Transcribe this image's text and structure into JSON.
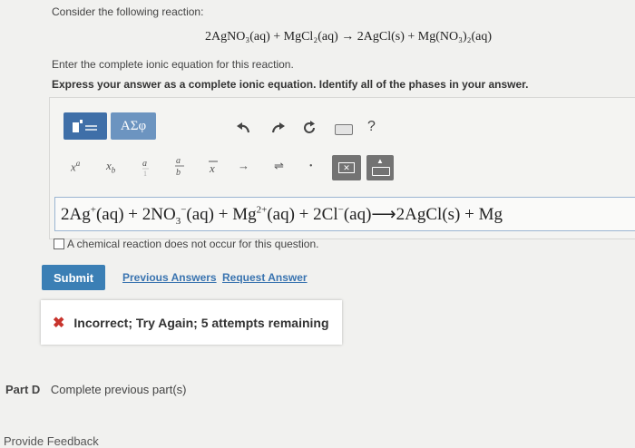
{
  "question": "Consider the following reaction:",
  "reaction": "2AgNO₃(aq) + MgCl₂(aq) → 2AgCl(s) + Mg(NO₃)₂(aq)",
  "prompt": "Enter the complete ionic equation for this reaction.",
  "instruction": "Express your answer as a complete ionic equation. Identify all of the phases in your answer.",
  "toolbar": {
    "greek_label": "ΑΣφ",
    "help_label": "?",
    "icons": [
      "templates-icon",
      "greek-letters-icon",
      "undo-icon",
      "redo-icon",
      "reset-icon",
      "keyboard-shortcuts-icon",
      "help-icon"
    ]
  },
  "symbols": {
    "superscript": "x",
    "superscript_exp": "a",
    "subscript": "x",
    "subscript_sub": "b",
    "arrow": "→",
    "equilibrium": "⇌",
    "dot": "•"
  },
  "answer": {
    "parts": [
      {
        "text": "2Ag"
      },
      {
        "sup": "+"
      },
      {
        "text": "(aq) + 2NO"
      },
      {
        "sub": "3"
      },
      {
        "sup": "−"
      },
      {
        "text": "(aq) + Mg"
      },
      {
        "sup": "2+"
      },
      {
        "text": "(aq) + 2Cl"
      },
      {
        "sup": "−"
      },
      {
        "text": "(aq)⟶2AgCl(s) + Mg"
      }
    ]
  },
  "no_reaction_label": "A chemical reaction does not occur for this question.",
  "buttons": {
    "submit": "Submit",
    "previous_answers": "Previous Answers",
    "request_answer": "Request Answer"
  },
  "feedback": "Incorrect; Try Again; 5 attempts remaining",
  "part_d": {
    "label": "Part D",
    "text": "Complete previous part(s)"
  },
  "provide_feedback": "Provide Feedback",
  "colors": {
    "accent": "#3b7fb5",
    "error": "#c8342d",
    "toolbar_button": "#6c94c0"
  }
}
